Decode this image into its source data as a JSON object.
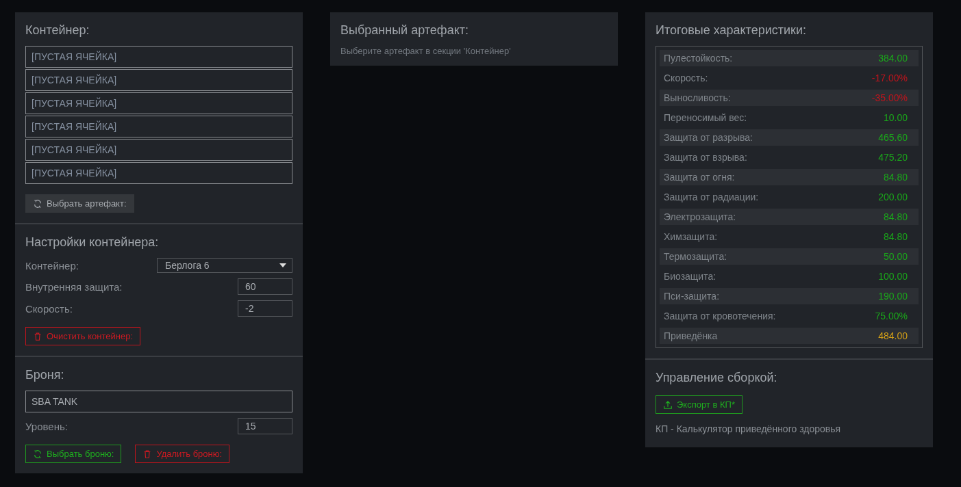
{
  "container": {
    "title": "Контейнер:",
    "slots": [
      "[ПУСТАЯ ЯЧЕЙКА]",
      "[ПУСТАЯ ЯЧЕЙКА]",
      "[ПУСТАЯ ЯЧЕЙКА]",
      "[ПУСТАЯ ЯЧЕЙКА]",
      "[ПУСТАЯ ЯЧЕЙКА]",
      "[ПУСТАЯ ЯЧЕЙКА]"
    ],
    "button": {
      "label": "Выбрать артефакт:",
      "kind": "choose"
    }
  },
  "settings": {
    "title": "Настройки контейнера:",
    "container_select": {
      "label": "Контейнер:",
      "value": "Берлога 6"
    },
    "fields": [
      {
        "label": "Внутренняя защита:",
        "value": "60"
      },
      {
        "label": "Скорость:",
        "value": "-2"
      }
    ],
    "button": {
      "label": "Очистить контейнер:",
      "kind": "danger"
    }
  },
  "armor": {
    "title": "Броня:",
    "name": "SBA TANK",
    "level": {
      "label": "Уровень:",
      "value": "15"
    },
    "buttons": [
      {
        "label": "Выбрать броню:",
        "kind": "confirm"
      },
      {
        "label": "Удалить броню:",
        "kind": "danger"
      }
    ]
  },
  "selected_artifact": {
    "title": "Выбранный артефакт:",
    "hint": "Выберите артефакт в секции 'Контейнер'"
  },
  "totals": {
    "title": "Итоговые характеристики:",
    "stats": [
      {
        "name": "Пулестойкость:",
        "value": "384.00",
        "color": "#1aa81a"
      },
      {
        "name": "Скорость:",
        "value": "-17.00%",
        "color": "#c0141c"
      },
      {
        "name": "Выносливость:",
        "value": "-35.00%",
        "color": "#c0141c"
      },
      {
        "name": "Переносимый вес:",
        "value": "10.00",
        "color": "#1aa81a"
      },
      {
        "name": "Защита от разрыва:",
        "value": "465.60",
        "color": "#1aa81a"
      },
      {
        "name": "Защита от взрыва:",
        "value": "475.20",
        "color": "#1aa81a"
      },
      {
        "name": "Защита от огня:",
        "value": "84.80",
        "color": "#1aa81a"
      },
      {
        "name": "Защита от радиации:",
        "value": "200.00",
        "color": "#1aa81a"
      },
      {
        "name": "Электрозащита:",
        "value": "84.80",
        "color": "#1aa81a"
      },
      {
        "name": "Химзащита:",
        "value": "84.80",
        "color": "#1aa81a"
      },
      {
        "name": "Термозащита:",
        "value": "50.00",
        "color": "#1aa81a"
      },
      {
        "name": "Биозащита:",
        "value": "100.00",
        "color": "#1aa81a"
      },
      {
        "name": "Пси-защита:",
        "value": "190.00",
        "color": "#1aa81a"
      },
      {
        "name": "Защита от кровотечения:",
        "value": "75.00%",
        "color": "#1aa81a"
      },
      {
        "name": "Приведёнка",
        "value": "484.00",
        "color": "#d4a017"
      }
    ]
  },
  "build": {
    "title": "Управление сборкой:",
    "button": {
      "label": "Экспорт в КП*",
      "kind": "export"
    },
    "note": "КП - Калькулятор приведённого здоровья"
  }
}
